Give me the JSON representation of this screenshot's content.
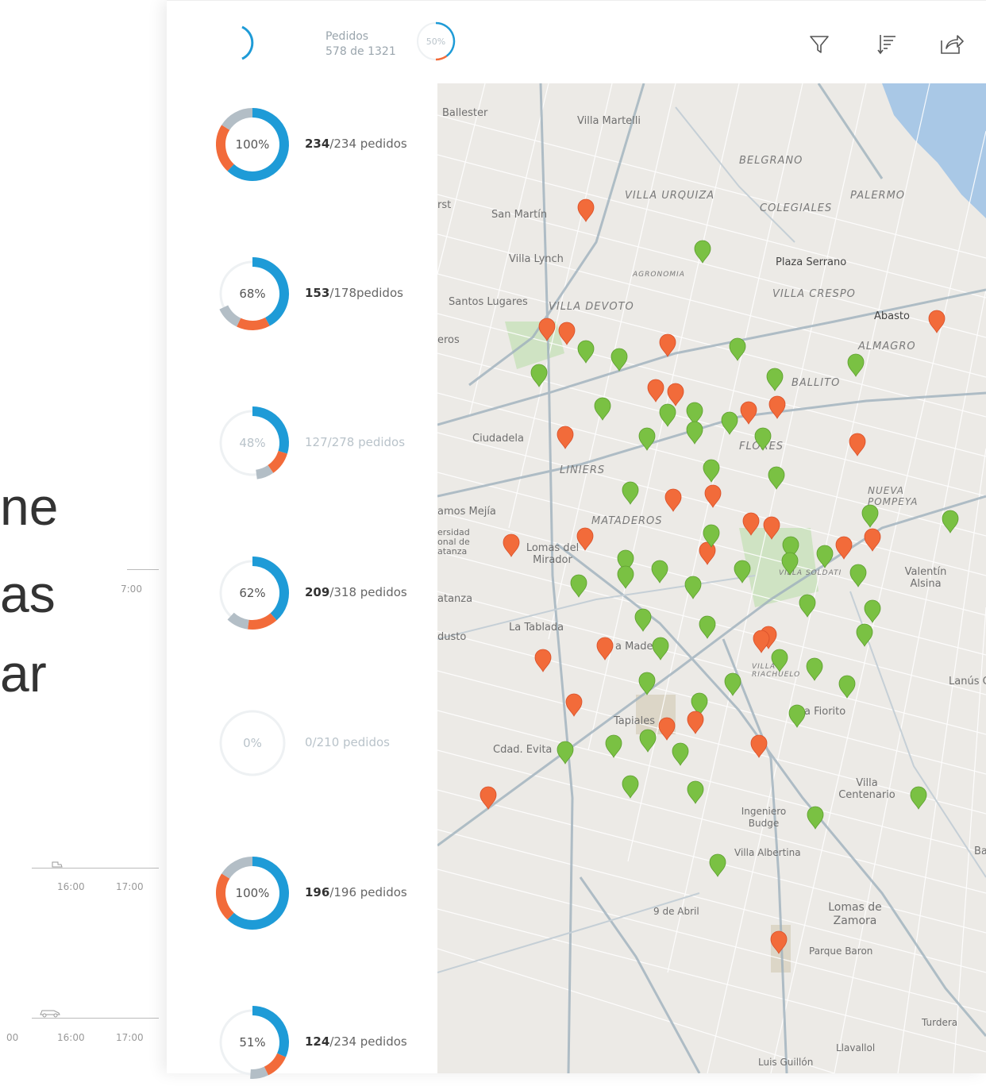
{
  "background": {
    "fragment_lines": [
      "ne",
      "as",
      "ar"
    ],
    "tick_top": "7:00",
    "ticks_mid": [
      "16:00",
      "17:00"
    ],
    "ticks_bottom": [
      "00",
      "16:00",
      "17:00"
    ]
  },
  "header": {
    "pedidos_label": "Pedidos",
    "pedidos_count": "578 de 1321",
    "pedidos_percent": "50%",
    "pedidos_fraction": 0.5
  },
  "toolbar": {
    "filter_icon": "filter-icon",
    "sort_icon": "sort-icon",
    "share_icon": "share-icon"
  },
  "routes": [
    {
      "percent_label": "100%",
      "done": "234",
      "total": "/234 pedidos",
      "progress": 1.0,
      "faded": false
    },
    {
      "percent_label": "68%",
      "done": "153",
      "total": "/178pedidos",
      "progress": 0.68,
      "faded": false
    },
    {
      "percent_label": "48%",
      "done": "127",
      "total": "/278 pedidos",
      "progress": 0.48,
      "faded": true
    },
    {
      "percent_label": "62%",
      "done": "209",
      "total": "/318 pedidos",
      "progress": 0.62,
      "faded": false
    },
    {
      "percent_label": "0%",
      "done": "0",
      "total": "/210 pedidos",
      "progress": 0.0,
      "faded": true
    },
    {
      "percent_label": "100%",
      "done": "196",
      "total": "/196 pedidos",
      "progress": 1.0,
      "faded": false
    },
    {
      "percent_label": "51%",
      "done": "124",
      "total": "/234 pedidos",
      "progress": 0.51,
      "faded": false
    }
  ],
  "colors": {
    "blue": "#1e9bd7",
    "orange": "#f26b3a",
    "grey": "#b3bec6",
    "green_pin": "#7ac143",
    "red_pin": "#f26b3a"
  },
  "map": {
    "labels": {
      "ballester": "Ballester",
      "villa_martelli": "Villa Martelli",
      "belgrano": "BELGRANO",
      "villa_urquiza": "VILLA URQUIZA",
      "palermo": "PALERMO",
      "colegiales": "COLEGIALES",
      "san_martin": "San Martín",
      "villa_lynch": "Villa Lynch",
      "plaza_serrano": "Plaza Serrano",
      "agronomia": "AGRONOMIA",
      "villa_crespo": "VILLA CRESPO",
      "santos_lugares": "Santos Lugares",
      "villa_devoto": "VILLA DEVOTO",
      "abasto": "Abasto",
      "almagro": "ALMAGRO",
      "caballito": "BALLITO",
      "ciudadela": "Ciudadela",
      "liniers": "LINIERS",
      "flores": "FLORES",
      "nueva_pompeya": "NUEVA POMPEYA",
      "ramos_mejia": "amos Mejía",
      "mataderos": "MATADEROS",
      "lomas_del_mirador": "Lomas del Mirador",
      "valentin_alsina": "Valentín Alsina",
      "villa_soldati": "VILLA SOLDATI",
      "la_tablada": "La Tablada",
      "madero": "a Madero",
      "lanus": "Lanús O",
      "villa_riachuelo": "VILLA RIACHUELO",
      "fiorito": "a Fiorito",
      "tapiales": "Tapiales",
      "cdad_evita": "Cdad. Evita",
      "villa_centenario": "Villa Centenario",
      "ingeniero_budge": "Ingeniero Budge",
      "villa_albertina": "Villa Albertina",
      "nueve_abril": "9 de Abril",
      "lomas_de_zamora": "Lomas de Zamora",
      "parque_baron": "Parque Baron",
      "turdera": "Turdera",
      "llavallol": "Llavallol",
      "luis_guillon": "Luis Guillón",
      "banfield": "Banfi",
      "matanza": "atanza",
      "dusto": "dusto",
      "eros": "eros",
      "rst": "rst",
      "universidad": "ersidad onal de atanza"
    }
  }
}
